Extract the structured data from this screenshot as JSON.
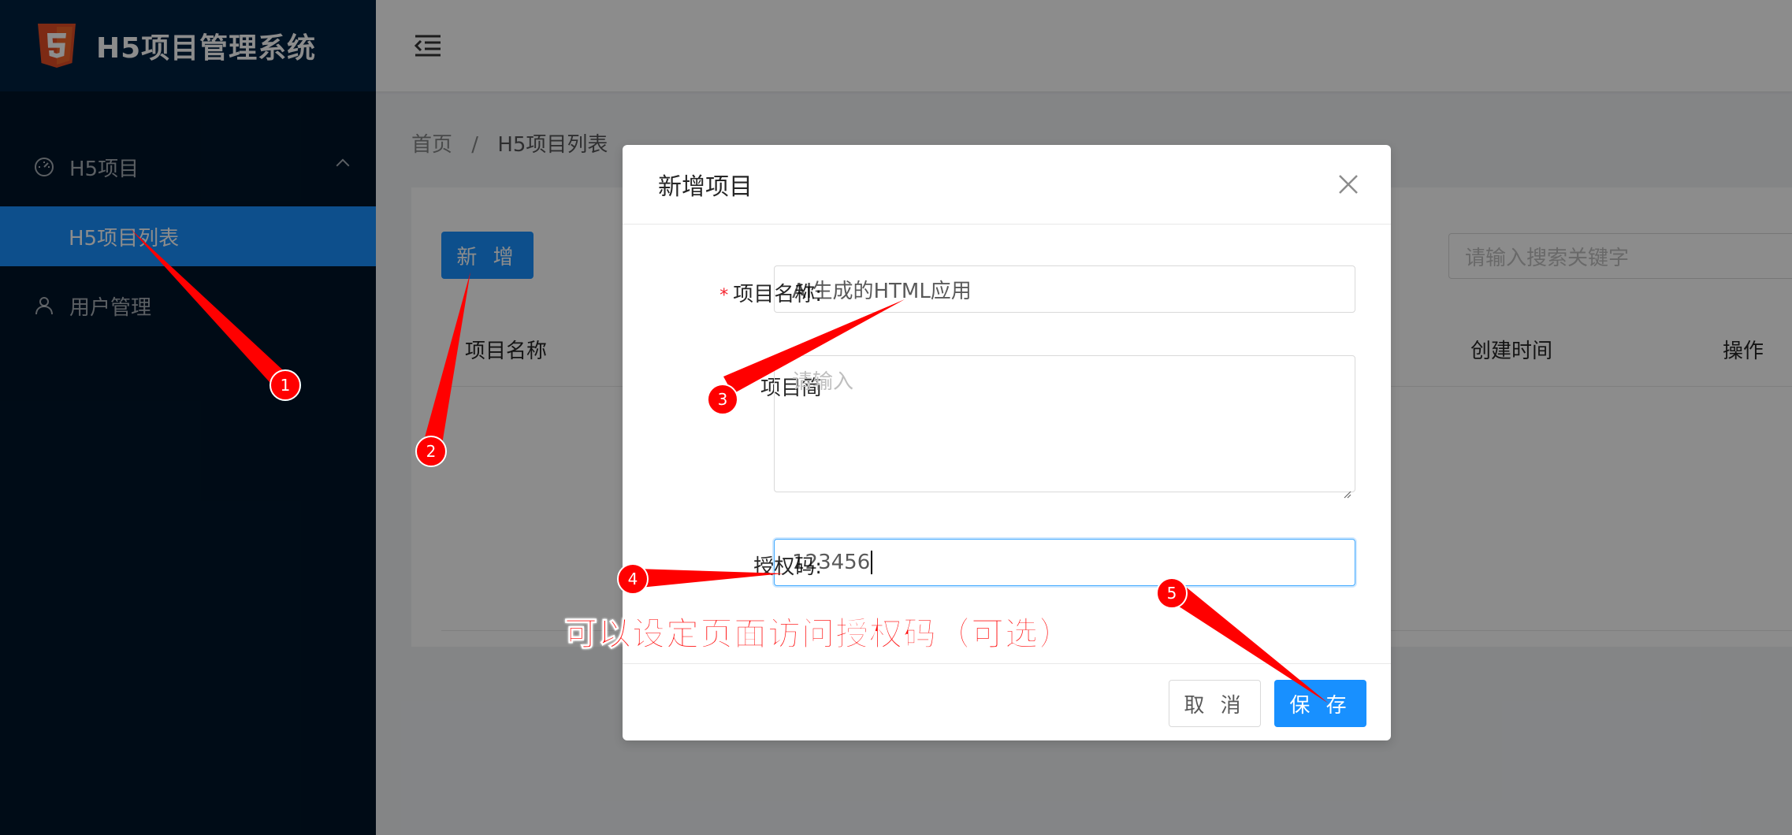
{
  "app": {
    "title": "H5项目管理系统"
  },
  "sidebar": {
    "group_label": "H5项目",
    "sub_item_label": "H5项目列表",
    "user_mgmt_label": "用户管理"
  },
  "breadcrumb": {
    "home": "首页",
    "separator": "/",
    "current": "H5项目列表"
  },
  "toolbar": {
    "add_label": "新 增",
    "search_placeholder": "请输入搜索关键字"
  },
  "table": {
    "columns": [
      "项目名称",
      "创建时间",
      "操作"
    ]
  },
  "modal": {
    "title": "新增项目",
    "fields": {
      "name_label": "项目名称:",
      "name_value": "AI生成的HTML应用",
      "desc_label": "项目简介:",
      "desc_label_visible": "项目简",
      "desc_placeholder": "请输入",
      "auth_label": "授权码:",
      "auth_value": "123456"
    },
    "cancel_label": "取 消",
    "save_label": "保 存"
  },
  "annotations": {
    "note": "可以设定页面访问授权码（可选）",
    "markers": [
      "1",
      "2",
      "3",
      "4",
      "5"
    ]
  },
  "colors": {
    "primary": "#1890ff",
    "sidebar_bg": "#001529",
    "annotation_red": "#ff0000"
  }
}
